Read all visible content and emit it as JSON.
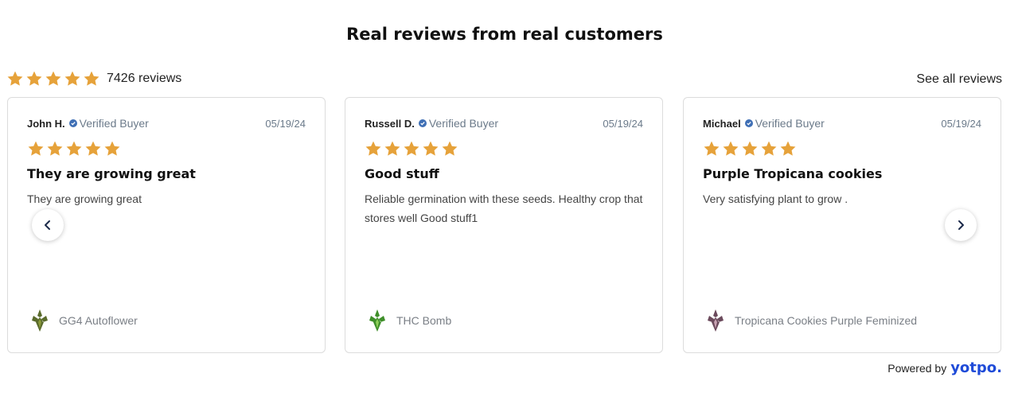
{
  "header": {
    "title": "Real reviews from real customers"
  },
  "summary": {
    "rating": 5,
    "count_text": "7426 reviews",
    "see_all": "See all reviews"
  },
  "colors": {
    "star": "#e6a23a",
    "verified": "#3f6fb5",
    "brand": "#1f4bd8"
  },
  "icons": {
    "star": "star-icon",
    "verified": "verified-check-icon",
    "prev": "chevron-left-icon",
    "next": "chevron-right-icon"
  },
  "reviews": [
    {
      "name": "John H.",
      "badge": "Verified Buyer",
      "date": "05/19/24",
      "rating": 5,
      "title": "They are growing great",
      "body": "They are growing great",
      "product": "GG4 Autoflower"
    },
    {
      "name": "Russell D.",
      "badge": "Verified Buyer",
      "date": "05/19/24",
      "rating": 5,
      "title": "Good stuff",
      "body": "Reliable germination with these seeds. Healthy crop that stores well Good stuff1",
      "product": "THC Bomb"
    },
    {
      "name": "Michael",
      "badge": "Verified Buyer",
      "date": "05/19/24",
      "rating": 5,
      "title": "Purple Tropicana cookies",
      "body": "Very satisfying plant to grow .",
      "product": "Tropicana Cookies Purple Feminized"
    }
  ],
  "footer": {
    "powered_by": "Powered by",
    "brand": "yotpo."
  }
}
